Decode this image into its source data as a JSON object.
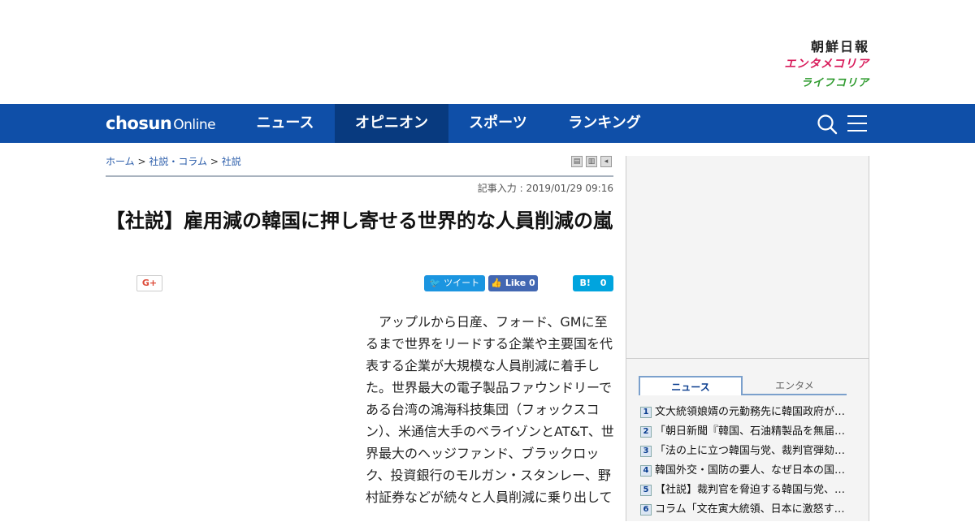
{
  "sister_sites": [
    "朝鮮日報",
    "エンタメコリア",
    "ライフコリア"
  ],
  "logo": {
    "bold": "chosun",
    "light": "Online"
  },
  "nav": [
    {
      "label": "ニュース"
    },
    {
      "label": "オピニオン"
    },
    {
      "label": "スポーツ"
    },
    {
      "label": "ランキング"
    }
  ],
  "icons": {
    "search": "search-icon",
    "menu": "menu-icon"
  },
  "breadcrumb": {
    "home": "ホーム",
    "sep": ">",
    "section": "社説・コラム",
    "sub": "社説"
  },
  "article": {
    "date": "記事入力 : 2019/01/29 09:16",
    "headline": "【社説】雇用減の韓国に押し寄せる世界的な人員削減の嵐",
    "body": "アップルから日産、フォード、GMに至るまで世界をリードする企業や主要国を代表する企業が大規模な人員削減に着手した。世界最大の電子製品ファウンドリーである台湾の鴻海科技集団（フォックスコン）、米通信大手のベライゾンとAT&T、世界最大のヘッジファンド、ブラックロック、投資銀行のモルガン・スタンレー、野村証券などが続々と人員削減に乗り出して"
  },
  "share": {
    "gplus": "G+",
    "tweet": "ツイート",
    "like": "Like",
    "like_count": "0",
    "hatena": "B!",
    "hatena_count": "0"
  },
  "sidebar": {
    "tabs": [
      "ニュース",
      "エンタメ"
    ],
    "ranking": [
      {
        "num": "1",
        "title": "文大統領娘婿の元勤務先に韓国政府が…"
      },
      {
        "num": "2",
        "title": "「朝日新聞『韓国、石油精製品を無届…"
      },
      {
        "num": "3",
        "title": "「法の上に立つ韓国与党、裁判官弾劾…"
      },
      {
        "num": "4",
        "title": "韓国外交・国防の要人、なぜ日本の国…"
      },
      {
        "num": "5",
        "title": "【社説】裁判官を脅迫する韓国与党、…"
      },
      {
        "num": "6",
        "title": "コラム「文在寅大統領、日本に激怒す…"
      }
    ]
  },
  "colors": {
    "nav": "#0f4fa8",
    "nav_active": "#083a7f",
    "link": "#2a5caa"
  }
}
